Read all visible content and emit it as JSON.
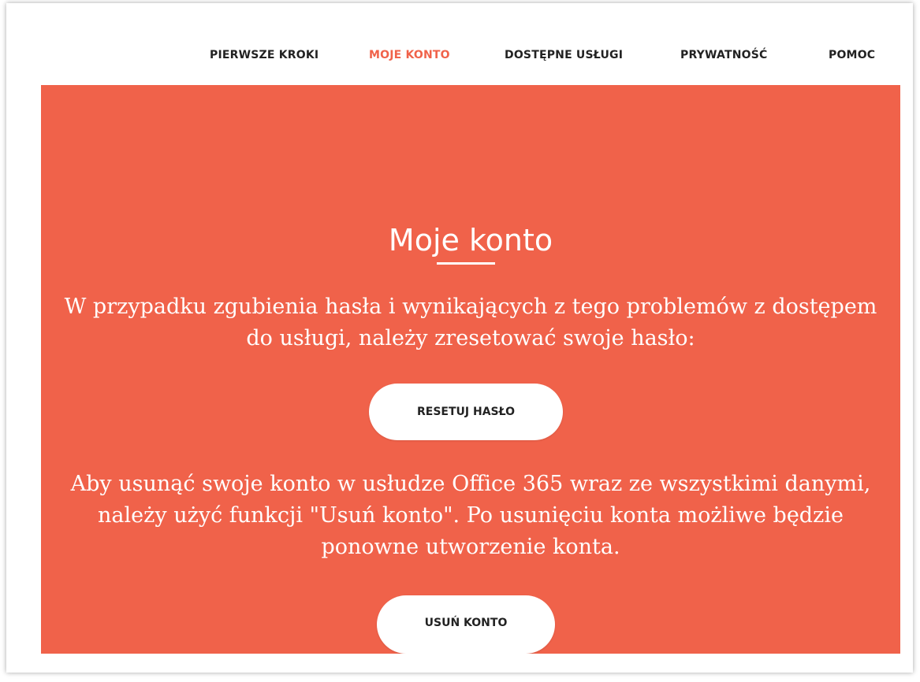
{
  "nav": {
    "items": [
      {
        "label": "PIERWSZE KROKI",
        "active": false
      },
      {
        "label": "MOJE KONTO",
        "active": true
      },
      {
        "label": "DOSTĘPNE USŁUGI",
        "active": false
      },
      {
        "label": "PRYWATNOŚĆ",
        "active": false
      },
      {
        "label": "POMOC",
        "active": false
      }
    ]
  },
  "hero": {
    "title": "Moje konto",
    "reset_text_line1": "W przypadku zgubienia hasła i wynikających z tego problemów z dostępem",
    "reset_text_line2": "do usługi, należy zresetować swoje hasło:",
    "reset_button": "RESETUJ HASŁO",
    "delete_text_line1": "Aby usunąć swoje konto w usłudze Office 365 wraz ze wszystkimi danymi,",
    "delete_text_line2": "należy użyć funkcji \"Usuń konto\". Po usunięciu konta możliwe będzie",
    "delete_text_line3": "ponowne utworzenie konta.",
    "delete_button": "USUŃ KONTO"
  },
  "colors": {
    "accent": "#f0624a",
    "background": "#ffffff",
    "text_dark": "#222222"
  }
}
